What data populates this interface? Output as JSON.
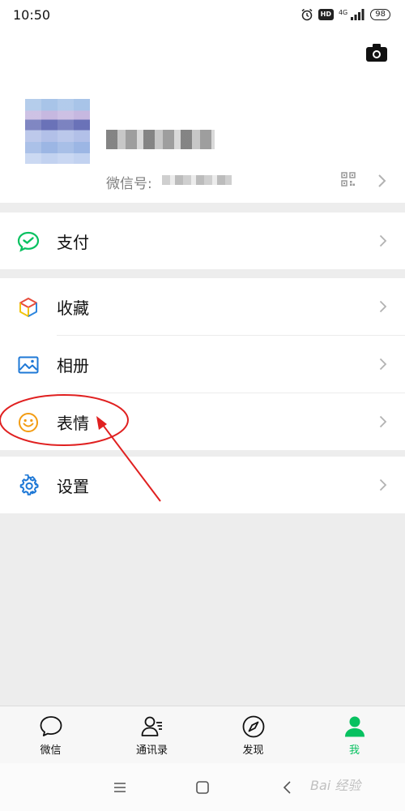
{
  "status_bar": {
    "time": "10:50",
    "hd": "HD",
    "network": "4G",
    "battery": "98"
  },
  "profile": {
    "wechat_id_label": "微信号:"
  },
  "menu": {
    "pay": "支付",
    "favorites": "收藏",
    "album": "相册",
    "stickers": "表情",
    "settings": "设置"
  },
  "tabs": [
    {
      "label": "微信",
      "icon": "chat-bubble-icon"
    },
    {
      "label": "通讯录",
      "icon": "contacts-icon"
    },
    {
      "label": "发现",
      "icon": "compass-icon"
    },
    {
      "label": "我",
      "icon": "person-icon"
    }
  ],
  "active_tab": "我",
  "colors": {
    "accent_green": "#07c160",
    "annotation_red": "#e02020",
    "sticker_orange": "#f39c12",
    "settings_blue": "#1e78d6"
  },
  "watermark": "Bai 经验"
}
